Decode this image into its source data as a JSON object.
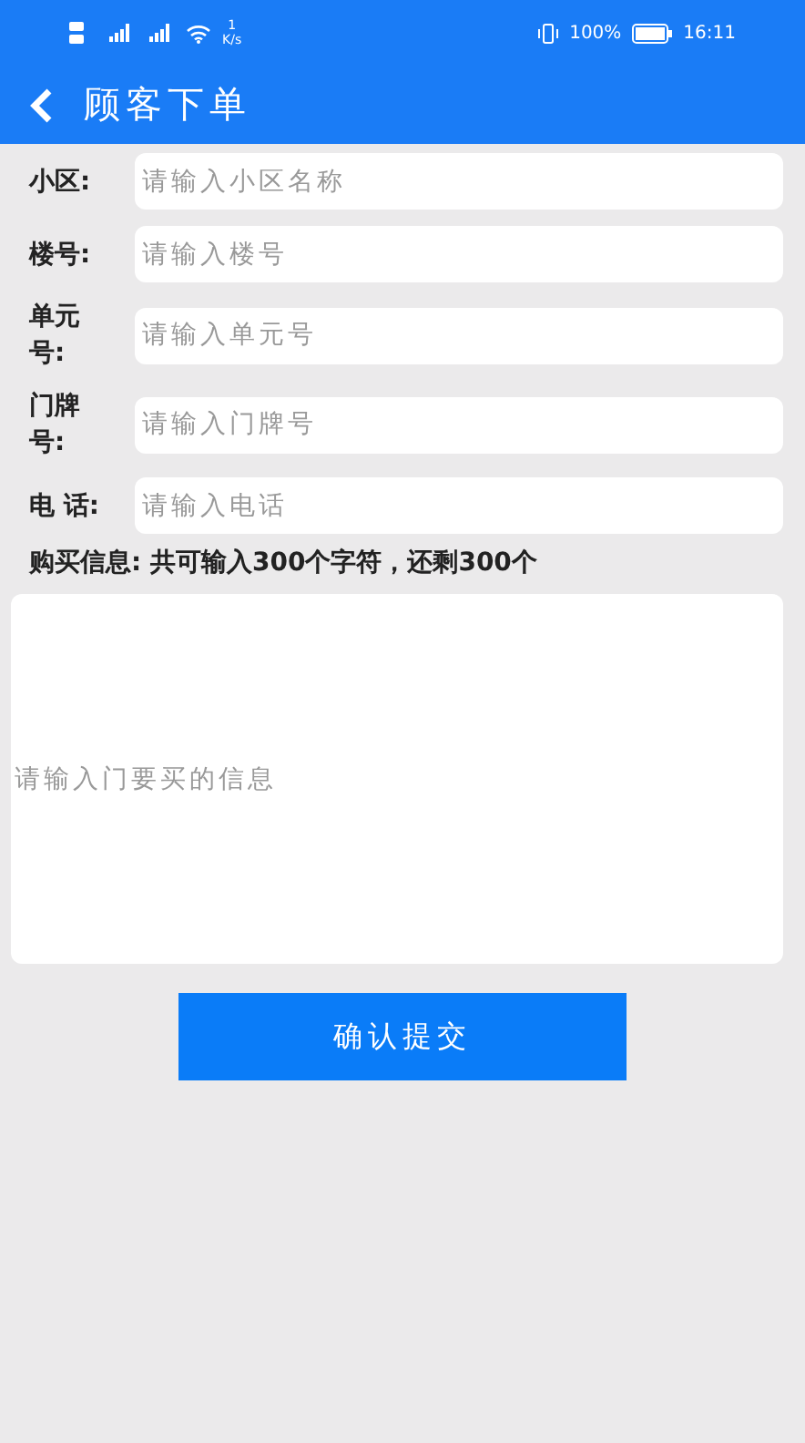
{
  "status_bar": {
    "net_speed_value": "1",
    "net_speed_unit": "K/s",
    "battery": "100%",
    "time": "16:11"
  },
  "header": {
    "title": "顾客下单"
  },
  "fields": [
    {
      "label": "小区:",
      "placeholder": "请输入小区名称"
    },
    {
      "label": "楼号:",
      "placeholder": "请输入楼号"
    },
    {
      "label": "单元号:",
      "placeholder": "请输入单元号"
    },
    {
      "label": "门牌号:",
      "placeholder": "请输入门牌号"
    },
    {
      "label": "电 话:",
      "placeholder": "请输入电话"
    }
  ],
  "purchase": {
    "label": "购买信息: 共可输入300个字符，还剩300个",
    "placeholder": "请输入门要买的信息"
  },
  "submit": "确认提交"
}
